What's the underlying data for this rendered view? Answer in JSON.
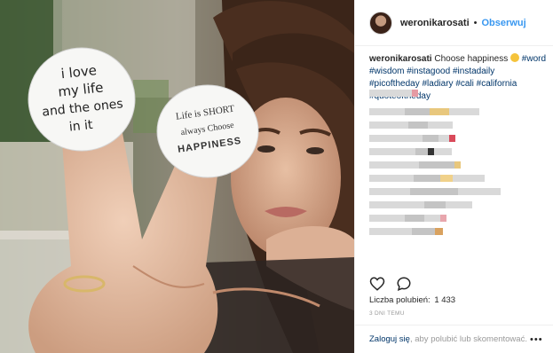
{
  "header": {
    "username": "weronikarosati",
    "separator": "•",
    "follow_label": "Obserwuj"
  },
  "photo": {
    "sticker_left": {
      "line1": "i love",
      "line2": "my life",
      "line3": "and the ones",
      "line4": "in it"
    },
    "sticker_right": {
      "line1": "Life is SHORT",
      "line2": "always Choose",
      "line3": "HAPPINESS"
    }
  },
  "caption": {
    "username": "weronikarosati",
    "text": "Choose happiness",
    "emoji": "slightly-smiling-face",
    "tags": [
      "#word",
      "#wisdom",
      "#instagood",
      "#instadaily",
      "#picoftheday",
      "#ladiary",
      "#cali",
      "#california",
      "#quoteoftheday"
    ]
  },
  "actions": {
    "like_icon": "heart-icon",
    "comment_icon": "comment-icon"
  },
  "likes": {
    "label": "Liczba polubień:",
    "count": "1 433"
  },
  "date": "3 DNI TEMU",
  "footer": {
    "login_link": "Zaloguj się",
    "login_text": ", aby polubić lub skomentować.",
    "more_label": "•••"
  },
  "colors": {
    "link": "#3897f0",
    "tag": "#003569",
    "text": "#262626",
    "muted": "#999999",
    "border": "#efefef"
  }
}
